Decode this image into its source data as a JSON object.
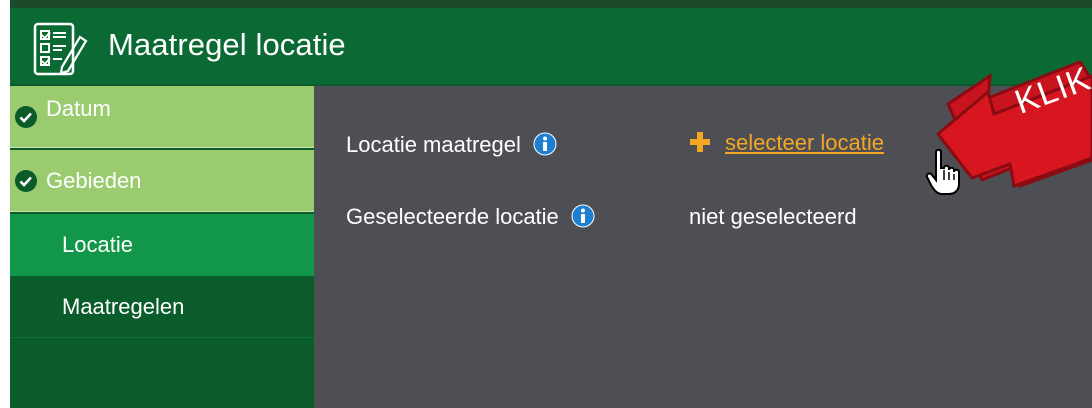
{
  "window": {
    "title": "Maatregel locatie",
    "icon": "checklist-edit-icon"
  },
  "sidebar": {
    "items": [
      {
        "label": "Datum",
        "state": "done",
        "icon": "check-circle-icon"
      },
      {
        "label": "Gebieden",
        "state": "done",
        "icon": "check-circle-icon"
      },
      {
        "label": "Locatie",
        "state": "active"
      },
      {
        "label": "Maatregelen",
        "state": "todo"
      }
    ]
  },
  "form": {
    "location_label": "Locatie maatregel",
    "location_action": "selecteer locatie",
    "selected_label": "Geselecteerde locatie",
    "selected_value": "niet geselecteerd"
  },
  "annotation": {
    "text": "KLIK"
  },
  "colors": {
    "titlebar": "#0b6a34",
    "sidebar_done": "#9acb6e",
    "sidebar_active": "#11964a",
    "sidebar_todo": "#0a5c2a",
    "main_bg": "#4d4f55",
    "accent": "#f5a623",
    "info_blue": "#1e7fd0",
    "annotation_red": "#c8141e"
  }
}
